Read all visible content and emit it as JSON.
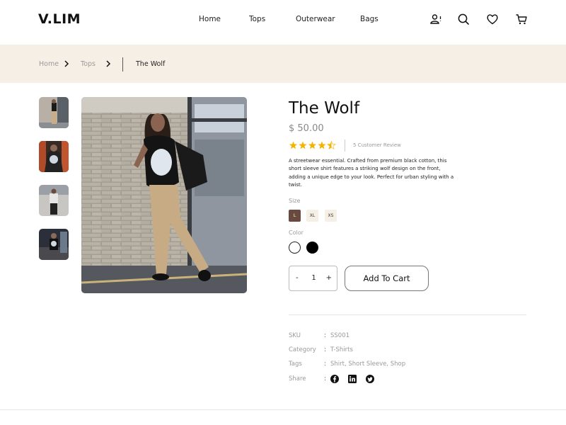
{
  "brand": {
    "logo": "V.LIM"
  },
  "nav": {
    "items": [
      "Home",
      "Tops",
      "Outerwear",
      "Bags"
    ]
  },
  "header_icons": [
    "user-icon",
    "search-icon",
    "heart-icon",
    "cart-icon"
  ],
  "breadcrumb": {
    "home": "Home",
    "section": "Tops",
    "current": "The Wolf"
  },
  "gallery": {
    "thumbnails": 4,
    "main_image": "man-in-wolf-tshirt-photo"
  },
  "product": {
    "title": "The Wolf",
    "price": "$ 50.00",
    "rating": 4.5,
    "rating_max": 5,
    "review_text": "5 Customer Review",
    "description": "A streetwear essential. Crafted from premium black cotton, this short sleeve shirt features a striking wolf design on the front, adding a unique edge to your look. Perfect for urban styling with a twist.",
    "size_label": "Size",
    "sizes": [
      "L",
      "XL",
      "XS"
    ],
    "selected_size": "L",
    "color_label": "Color",
    "colors": [
      "#ffffff",
      "#000000"
    ],
    "quantity": {
      "minus": "-",
      "value": "1",
      "plus": "+"
    },
    "add_to_cart": "Add To Cart"
  },
  "meta": {
    "sku_label": "SKU",
    "sku": "SS001",
    "category_label": "Category",
    "category": "T-Shirts",
    "tags_label": "Tags",
    "tags": "Shirt, Short Sleeve, Shop",
    "share_label": "Share",
    "colon": ":",
    "share_icons": [
      "facebook-icon",
      "linkedin-icon",
      "twitter-icon"
    ]
  },
  "theme": {
    "accent": "#6a4a3e",
    "band": "#f6efe6",
    "star": "#f5b301"
  }
}
